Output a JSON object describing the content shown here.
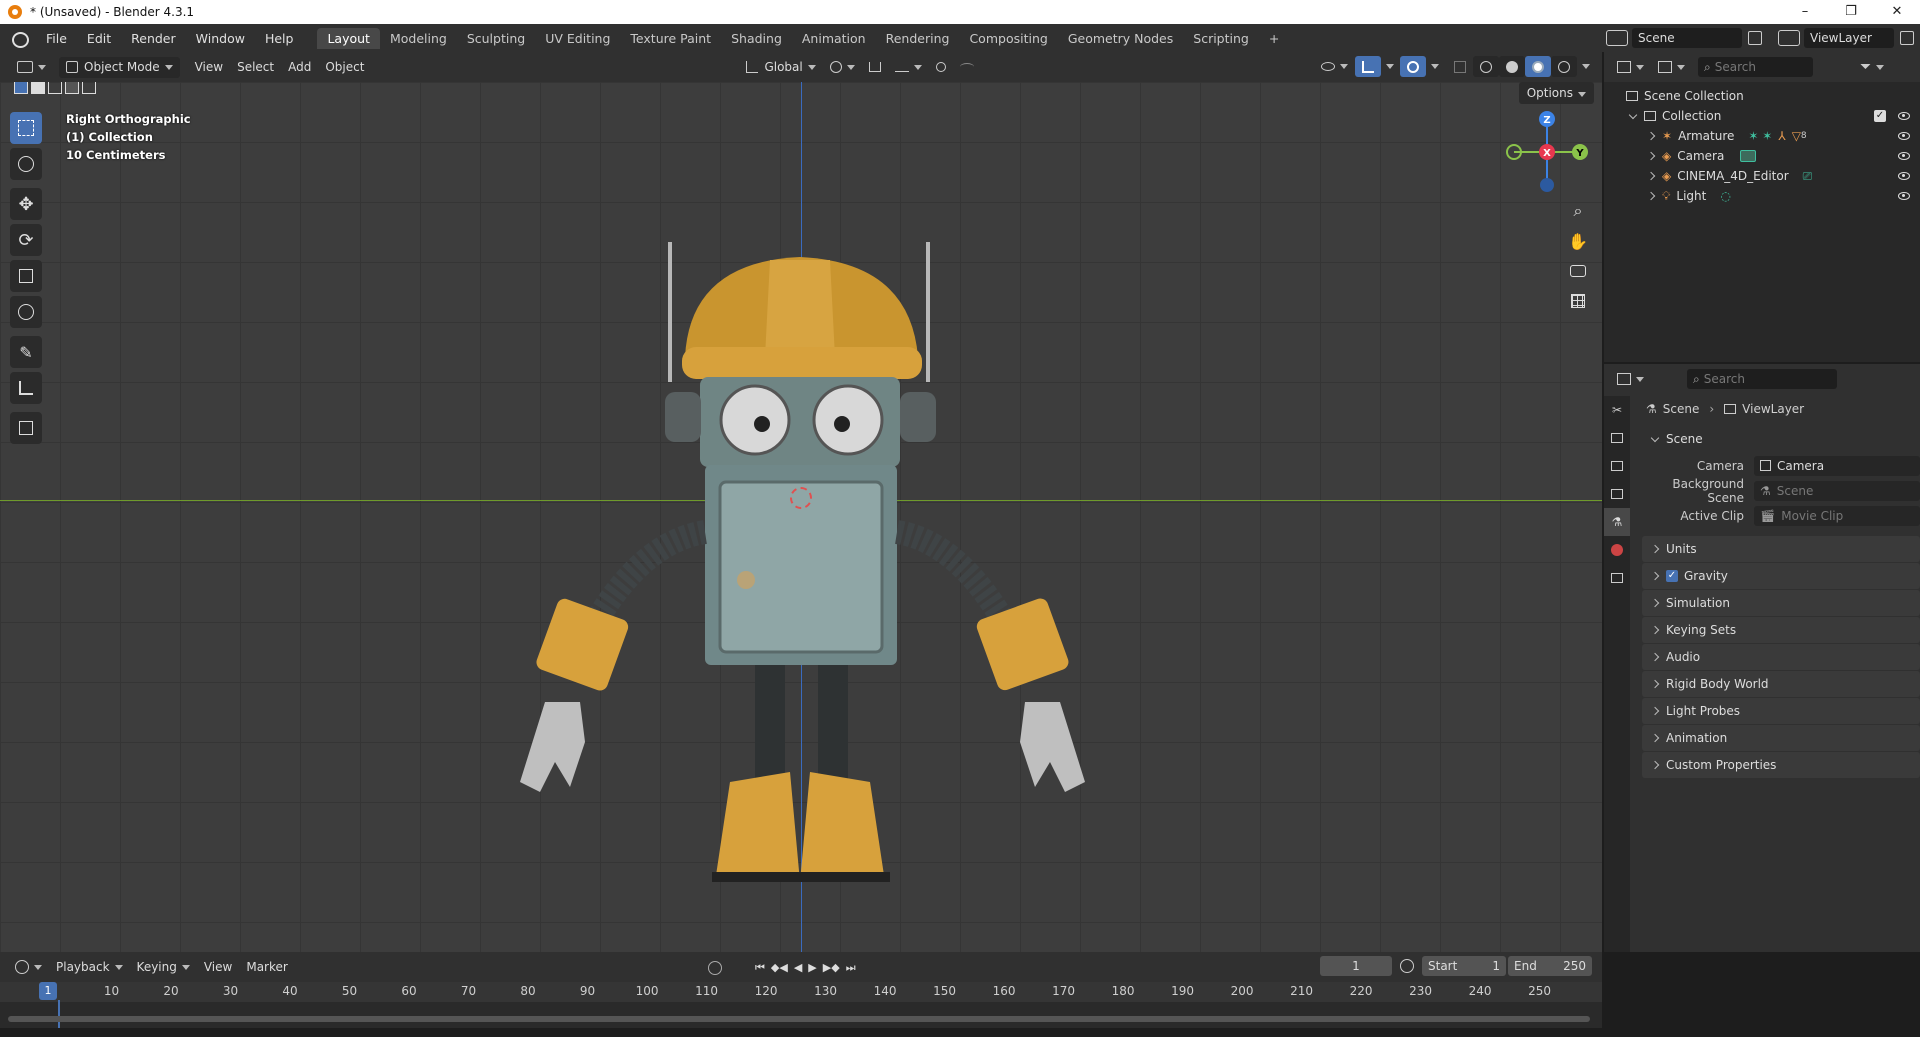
{
  "window": {
    "title": "* (Unsaved) - Blender 4.3.1",
    "minimize": "–",
    "restore": "❐",
    "close": "✕"
  },
  "menu": [
    "File",
    "Edit",
    "Render",
    "Window",
    "Help"
  ],
  "workspaces": [
    "Layout",
    "Modeling",
    "Sculpting",
    "UV Editing",
    "Texture Paint",
    "Shading",
    "Animation",
    "Rendering",
    "Compositing",
    "Geometry Nodes",
    "Scripting",
    "+"
  ],
  "active_workspace": "Layout",
  "topright": {
    "scene": "Scene",
    "view_layer": "ViewLayer"
  },
  "viewport_header": {
    "mode": "Object Mode",
    "menus": [
      "View",
      "Select",
      "Add",
      "Object"
    ],
    "orientation": "Global"
  },
  "viewport": {
    "info": [
      "Right Orthographic",
      "(1) Collection",
      "10 Centimeters"
    ],
    "options_label": "Options",
    "gizmo": {
      "z": "Z",
      "y": "Y",
      "x": "X"
    }
  },
  "outliner": {
    "search_placeholder": "Search",
    "root": "Scene Collection",
    "collection": "Collection",
    "items": [
      {
        "name": "Armature",
        "badge": "8"
      },
      {
        "name": "Camera"
      },
      {
        "name": "CINEMA_4D_Editor"
      },
      {
        "name": "Light"
      }
    ]
  },
  "properties": {
    "search_placeholder": "Search",
    "breadcrumb": [
      "Scene",
      "ViewLayer"
    ],
    "section": "Scene",
    "camera_label": "Camera",
    "camera_value": "Camera",
    "background_label": "Background Scene",
    "background_placeholder": "Scene",
    "clip_label": "Active Clip",
    "clip_placeholder": "Movie Clip",
    "panels": [
      "Units",
      "Gravity",
      "Simulation",
      "Keying Sets",
      "Audio",
      "Rigid Body World",
      "Light Probes",
      "Animation",
      "Custom Properties"
    ],
    "gravity_checked": true
  },
  "timeline": {
    "menus": [
      "Playback",
      "Keying",
      "View",
      "Marker"
    ],
    "current_frame": "1",
    "start_label": "Start",
    "start": "1",
    "end_label": "End",
    "end": "250",
    "ticks": [
      "10",
      "20",
      "30",
      "40",
      "50",
      "60",
      "70",
      "80",
      "90",
      "100",
      "110",
      "120",
      "130",
      "140",
      "150",
      "160",
      "170",
      "180",
      "190",
      "200",
      "210",
      "220",
      "230",
      "240",
      "250"
    ],
    "playhead": "1"
  },
  "colors": {
    "accent": "#4772b3",
    "x_axis": "#e8384f",
    "y_axis": "#8bc34a",
    "z_axis": "#3c83e6",
    "brand": "#e87d0d"
  }
}
